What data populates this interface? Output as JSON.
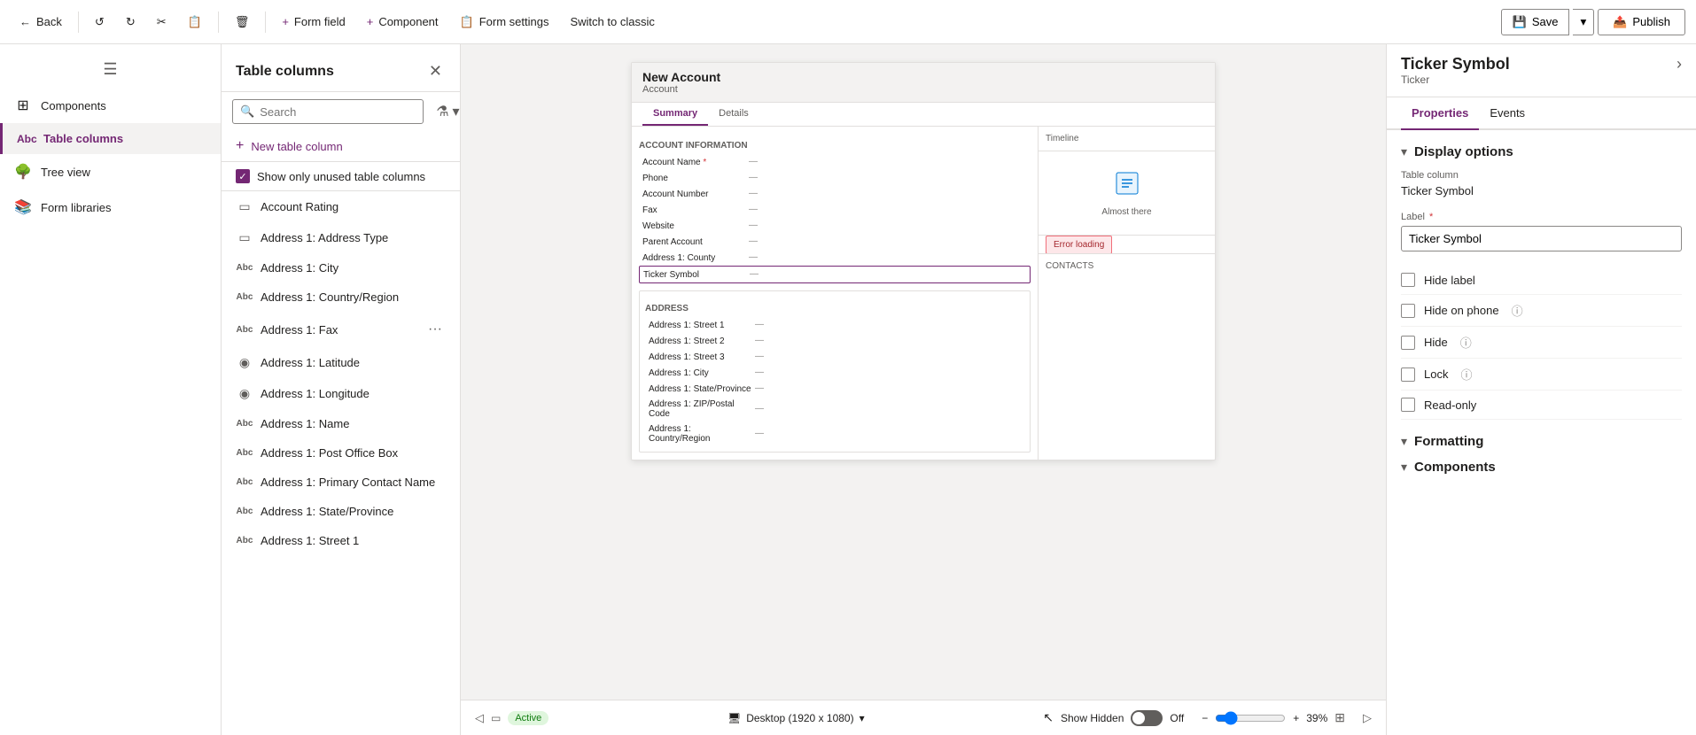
{
  "toolbar": {
    "back_label": "Back",
    "undo_label": "Undo",
    "redo_label": "Redo",
    "cut_label": "Cut",
    "paste_label": "Paste",
    "delete_label": "Delete",
    "form_field_label": "Form field",
    "component_label": "Component",
    "form_settings_label": "Form settings",
    "switch_label": "Switch to classic",
    "save_label": "Save",
    "publish_label": "Publish"
  },
  "left_nav": {
    "hamburger": "☰",
    "items": [
      {
        "id": "components",
        "label": "Components",
        "icon": "⊞"
      },
      {
        "id": "table-columns",
        "label": "Table columns",
        "icon": "Abc",
        "active": true
      },
      {
        "id": "tree-view",
        "label": "Tree view",
        "icon": "🌳"
      },
      {
        "id": "form-libraries",
        "label": "Form libraries",
        "icon": "📚"
      }
    ]
  },
  "columns_panel": {
    "title": "Table columns",
    "search_placeholder": "Search",
    "new_column_label": "New table column",
    "show_unused_label": "Show only unused table columns",
    "columns": [
      {
        "id": "account-rating",
        "icon": "▭",
        "label": "Account Rating"
      },
      {
        "id": "address-type",
        "icon": "▭",
        "label": "Address 1: Address Type"
      },
      {
        "id": "address-city",
        "icon": "Abc",
        "label": "Address 1: City"
      },
      {
        "id": "address-country",
        "icon": "Abc",
        "label": "Address 1: Country/Region"
      },
      {
        "id": "address-fax",
        "icon": "Abc",
        "label": "Address 1: Fax",
        "has_more": true
      },
      {
        "id": "address-latitude",
        "icon": "◉",
        "label": "Address 1: Latitude"
      },
      {
        "id": "address-longitude",
        "icon": "◉",
        "label": "Address 1: Longitude"
      },
      {
        "id": "address-name",
        "icon": "Abc",
        "label": "Address 1: Name"
      },
      {
        "id": "address-po-box",
        "icon": "Abc",
        "label": "Address 1: Post Office Box"
      },
      {
        "id": "address-primary-contact",
        "icon": "Abc",
        "label": "Address 1: Primary Contact Name"
      },
      {
        "id": "address-state",
        "icon": "Abc",
        "label": "Address 1: State/Province"
      },
      {
        "id": "address-street1",
        "icon": "Abc",
        "label": "Address 1: Street 1"
      }
    ]
  },
  "form_preview": {
    "title": "New Account",
    "subtitle": "Account",
    "tabs": [
      {
        "label": "Summary",
        "active": true
      },
      {
        "label": "Details"
      }
    ],
    "account_info_section": "ACCOUNT INFORMATION",
    "fields": [
      {
        "label": "Account Name",
        "value": "—",
        "required": true
      },
      {
        "label": "Phone",
        "value": "—"
      },
      {
        "label": "Account Number",
        "value": "—"
      },
      {
        "label": "Fax",
        "value": "—"
      },
      {
        "label": "Website",
        "value": "—"
      },
      {
        "label": "Parent Account",
        "value": "—"
      },
      {
        "label": "Address 1: County",
        "value": "—"
      },
      {
        "label": "Ticker Symbol",
        "value": "—",
        "highlighted": true
      }
    ],
    "timeline_label": "Timeline",
    "almost_there_text": "Almost there",
    "error_loading": "Error loading",
    "contacts_label": "CONTACTS",
    "address_section": "ADDRESS",
    "address_fields": [
      {
        "label": "Address 1: Street 1",
        "value": "—"
      },
      {
        "label": "Address 1: Street 2",
        "value": "—"
      },
      {
        "label": "Address 1: Street 3",
        "value": "—"
      },
      {
        "label": "Address 1: City",
        "value": "—"
      },
      {
        "label": "Address 1: State/Province",
        "value": "—"
      },
      {
        "label": "Address 1: ZIP/Postal Code",
        "value": "—"
      },
      {
        "label": "Address 1: Country/Region",
        "value": "—"
      }
    ],
    "active_label": "Active",
    "device_label": "Desktop (1920 x 1080)",
    "show_hidden_label": "Show Hidden",
    "toggle_state": "Off",
    "zoom_level": "39%"
  },
  "right_panel": {
    "title": "Ticker Symbol",
    "subtitle": "Ticker",
    "tabs": [
      {
        "label": "Properties",
        "active": true
      },
      {
        "label": "Events"
      }
    ],
    "display_options_section": "Display options",
    "table_column_label": "Table column",
    "table_column_value": "Ticker Symbol",
    "label_field_label": "Label",
    "label_field_value": "Ticker Symbol",
    "checkboxes": [
      {
        "id": "hide-label",
        "label": "Hide label",
        "checked": false
      },
      {
        "id": "hide-on-phone",
        "label": "Hide on phone",
        "checked": false,
        "has_info": true
      },
      {
        "id": "hide",
        "label": "Hide",
        "checked": false,
        "has_info": true
      },
      {
        "id": "lock",
        "label": "Lock",
        "checked": false,
        "has_info": true
      },
      {
        "id": "read-only",
        "label": "Read-only",
        "checked": false
      }
    ],
    "formatting_section": "Formatting",
    "components_section": "Components"
  }
}
